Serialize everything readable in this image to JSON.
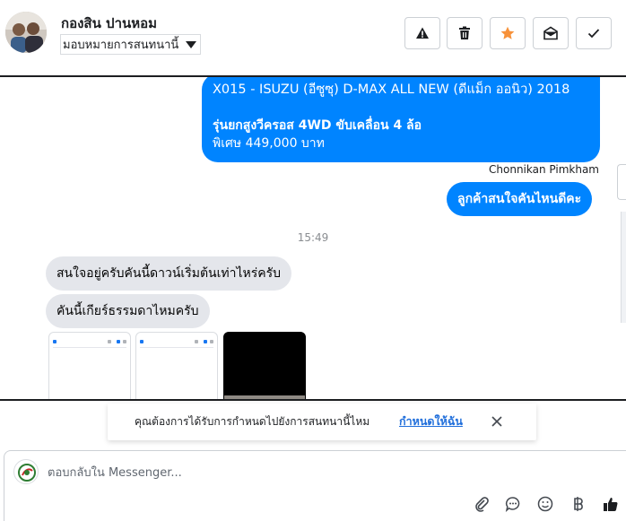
{
  "header": {
    "contact_name": "กองสิน ปานหอม",
    "assign_label": "มอบหมายการสนทนานี้",
    "actions": [
      "spam",
      "delete",
      "star",
      "mark-unread",
      "done"
    ]
  },
  "messages": {
    "outgoing_block": {
      "line1": "X015 - ISUZU (อีซูซุ) D-MAX ALL NEW (ดีแม็ก ออนิว) 2018",
      "line2": " รุ่นยกสูงวีครอส 4WD ขับเคลื่อน 4 ล้อ",
      "line3": "พิเศษ 449,000 บาท"
    },
    "sender_name": "Chonnikan Pimkham",
    "outgoing_short": "ลูกค้าสนใจคันไหนดีคะ",
    "timestamp": "15:49",
    "incoming_1": "สนใจอยู่ครับคันนี้ดาวน์เริ่มต้นเท่าไหร่ครับ",
    "incoming_2": "คันนี้เกียร์ธรรมดาไหมครับ"
  },
  "notice": {
    "text": "คุณต้องการได้รับการกำหนดไปยังการสนทนานี้ไหม",
    "link": "กำหนดให้ฉัน"
  },
  "composer": {
    "placeholder": "ตอบกลับใน Messenger...",
    "icons": [
      "attachment-icon",
      "comment-icon",
      "emoji-icon",
      "baht-icon",
      "thumbs-up-icon"
    ]
  },
  "colors": {
    "outgoing_bubble": "#0084ff",
    "incoming_bubble": "#e4e6eb",
    "star_accent": "#f7923a",
    "link": "#216fdb"
  }
}
